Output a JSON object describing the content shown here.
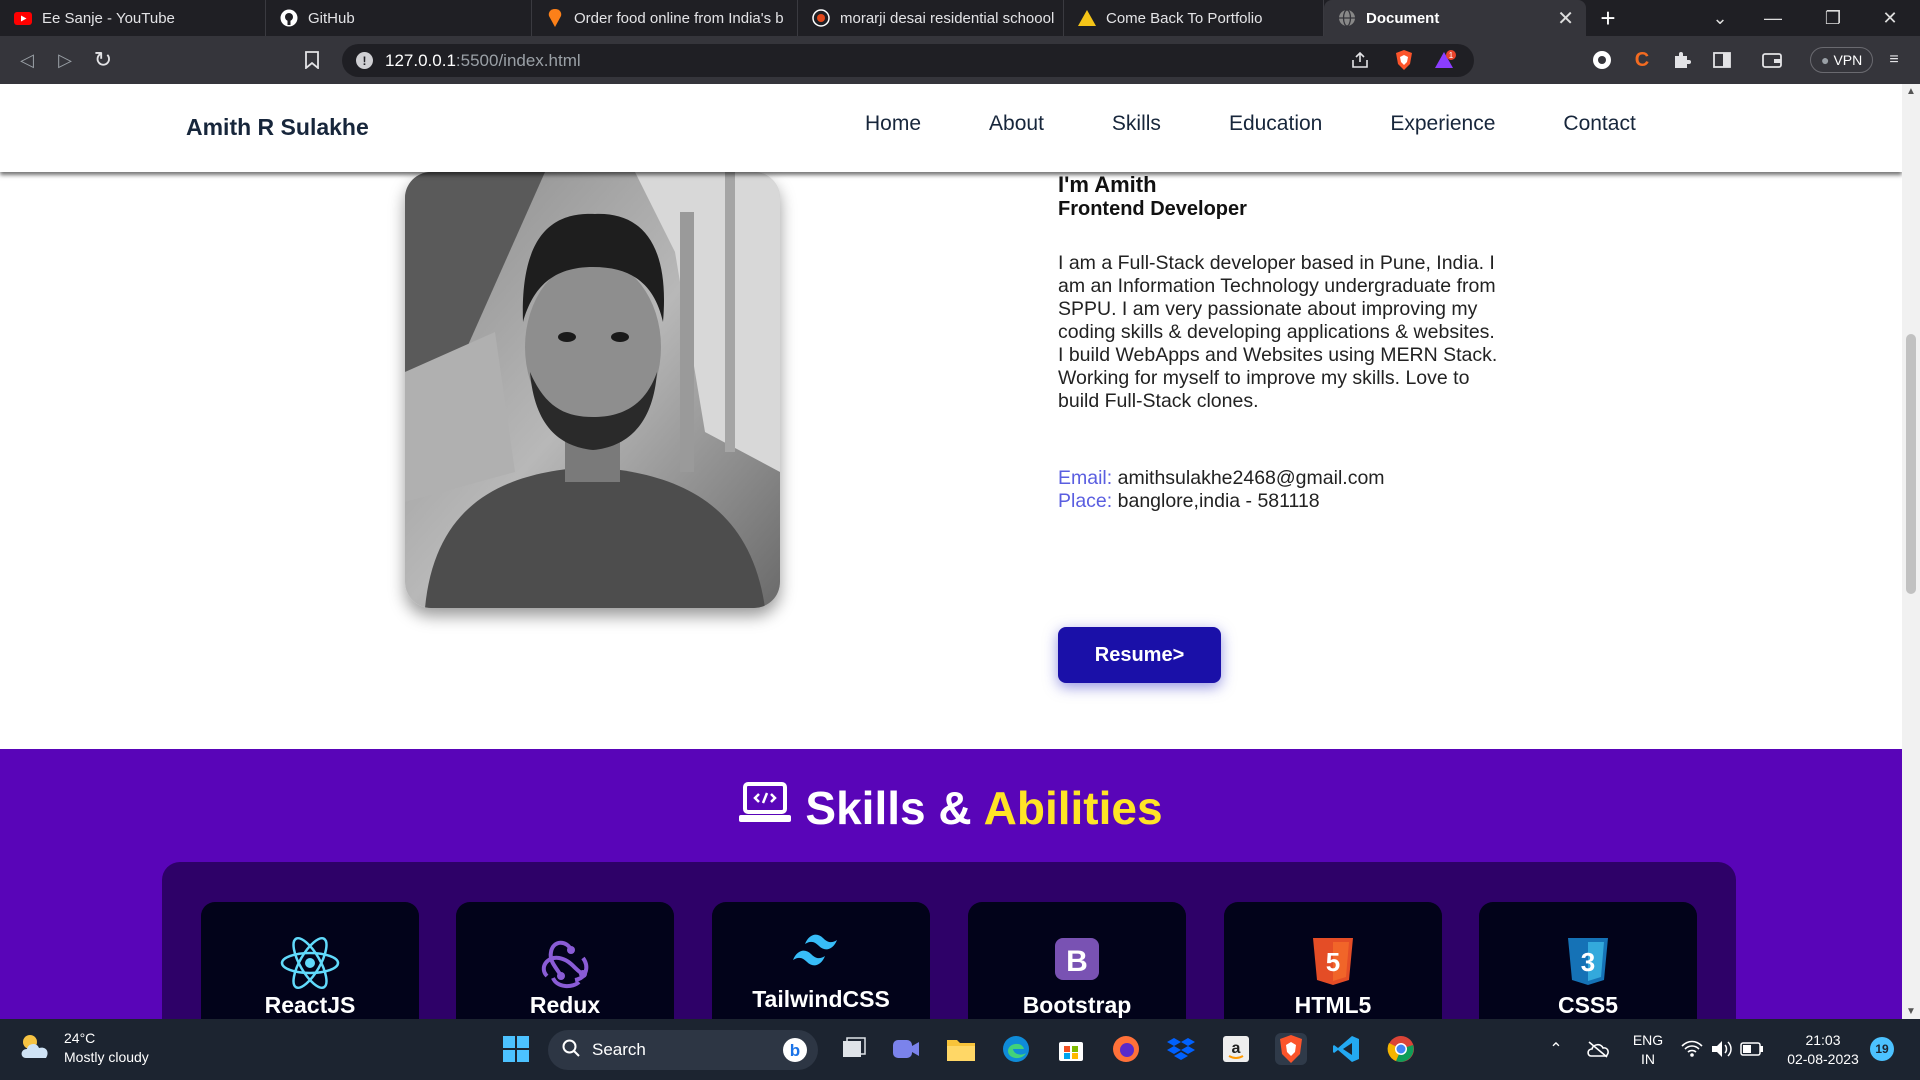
{
  "browser": {
    "tabs": [
      {
        "title": "Ee Sanje - YouTube",
        "icon": "youtube-icon"
      },
      {
        "title": "GitHub",
        "icon": "github-icon"
      },
      {
        "title": "Order food online from India's b",
        "icon": "swiggy-icon"
      },
      {
        "title": "morarji desai residential schoool",
        "icon": "brave-shield-icon"
      },
      {
        "title": "Come Back To Portfolio",
        "icon": "vercel-icon"
      },
      {
        "title": "Document",
        "icon": "globe-icon",
        "active": true
      }
    ],
    "url_host": "127.0.0.1",
    "url_path": ":5500/index.html",
    "vpn_label": "VPN",
    "brave_badge": "1"
  },
  "site": {
    "brand": "Amith R Sulakhe",
    "nav": [
      "Home",
      "About",
      "Skills",
      "Education",
      "Experience",
      "Contact"
    ]
  },
  "hero": {
    "name": "I'm Amith",
    "role": "Frontend Developer",
    "bio": "I am a Full-Stack developer based in Pune, India. I am an Information Technology undergraduate from SPPU. I am very passionate about improving my coding skills & developing applications & websites. I build WebApps and Websites using MERN Stack. Working for myself to improve my skills. Love to build Full-Stack clones.",
    "email_label": "Email:",
    "email": "amithsulakhe2468@gmail.com",
    "place_label": "Place:",
    "place": "banglore,india - 581118",
    "resume_button": "Resume>"
  },
  "skills": {
    "heading_main": "Skills &",
    "heading_accent": "Abilities",
    "items": [
      {
        "name": "ReactJS",
        "icon": "react-icon"
      },
      {
        "name": "Redux",
        "icon": "redux-icon"
      },
      {
        "name": "TailwindCSS",
        "icon": "tailwind-icon"
      },
      {
        "name": "Bootstrap",
        "icon": "bootstrap-icon"
      },
      {
        "name": "HTML5",
        "icon": "html5-icon"
      },
      {
        "name": "CSS5",
        "icon": "css3-icon"
      }
    ]
  },
  "taskbar": {
    "weather_temp": "24°C",
    "weather_desc": "Mostly cloudy",
    "search_label": "Search",
    "lang_top": "ENG",
    "lang_bottom": "IN",
    "time": "21:03",
    "date": "02-08-2023",
    "notification_count": "19"
  },
  "colors": {
    "skills_bg": "#5905b8",
    "skills_box": "#2e0168",
    "accent_yellow": "#ffe426",
    "resume_btn": "#1a10a8",
    "contact_key": "#5a5ee0"
  }
}
